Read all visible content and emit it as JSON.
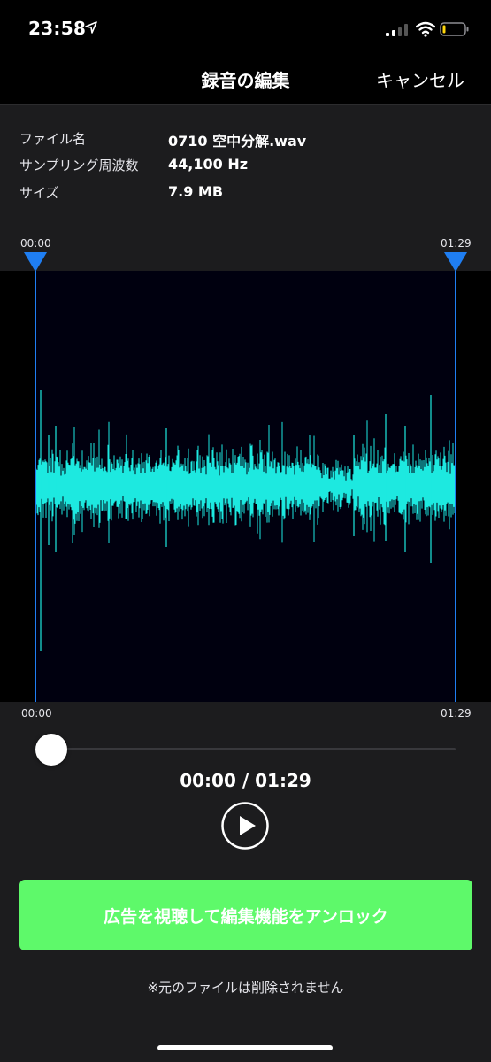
{
  "status_bar": {
    "time": "23:58"
  },
  "nav": {
    "title": "録音の編集",
    "cancel_label": "キャンセル"
  },
  "file_info": [
    {
      "label": "ファイル名",
      "value": "0710 空中分解.wav"
    },
    {
      "label": "サンプリング周波数",
      "value": "44,100 Hz"
    },
    {
      "label": "サイズ",
      "value": "7.9 MB"
    }
  ],
  "trim": {
    "start_label": "00:00",
    "end_label": "01:29"
  },
  "waveform_axis": {
    "start_label": "00:00",
    "end_label": "01:29"
  },
  "playback": {
    "position": 0.0,
    "timecode": "00:00 / 01:29"
  },
  "unlock_button": {
    "label": "広告を視聴して編集機能をアンロック"
  },
  "note": "※元のファイルは削除されません",
  "colors": {
    "waveform": "#1de9e0",
    "marker": "#1f7ef2",
    "unlock": "#5ef96a",
    "wave_bg": "#00000f"
  }
}
